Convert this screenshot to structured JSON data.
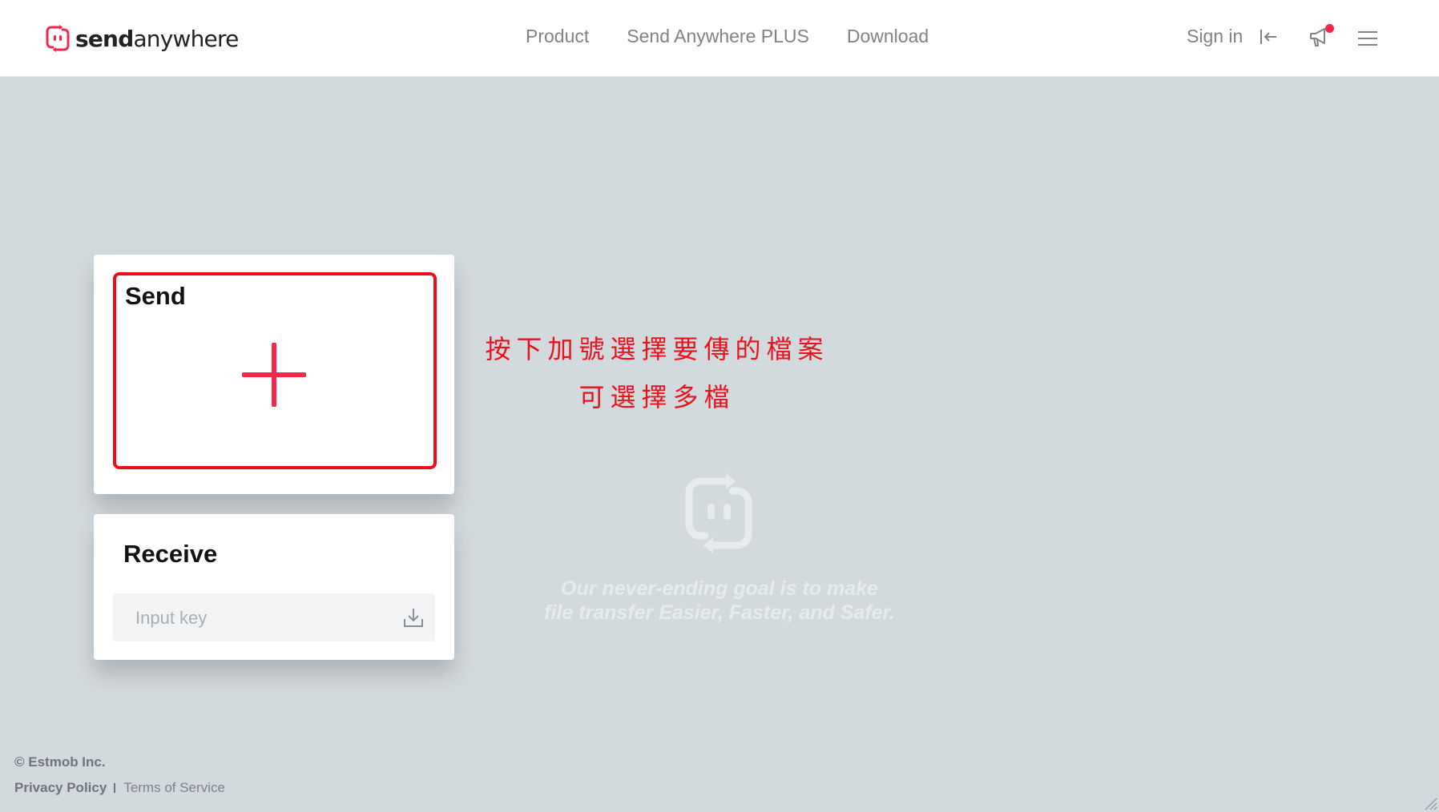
{
  "header": {
    "logo": {
      "bold": "send",
      "rest": "anywhere"
    },
    "nav": [
      "Product",
      "Send Anywhere PLUS",
      "Download"
    ],
    "signin_label": "Sign in"
  },
  "send_card": {
    "title": "Send"
  },
  "receive_card": {
    "title": "Receive",
    "input_placeholder": "Input key",
    "input_value": ""
  },
  "annotation": {
    "line1": "按下加號選擇要傳的檔案",
    "line2": "可選擇多檔"
  },
  "tagline": {
    "line1": "Our never-ending goal is to make",
    "line2": "file transfer Easier, Faster, and Safer."
  },
  "footer": {
    "copyright": "© Estmob Inc.",
    "privacy": "Privacy Policy",
    "terms": "Terms of Service"
  },
  "colors": {
    "brand": "#f5284b",
    "annotation": "#e8131c",
    "background": "#d3dade"
  },
  "icons": {
    "logo": "send-anywhere-logo-icon",
    "signin": "sign-in-arrow-icon",
    "notice": "megaphone-icon",
    "menu": "hamburger-menu-icon",
    "add": "plus-icon",
    "download": "download-icon"
  }
}
